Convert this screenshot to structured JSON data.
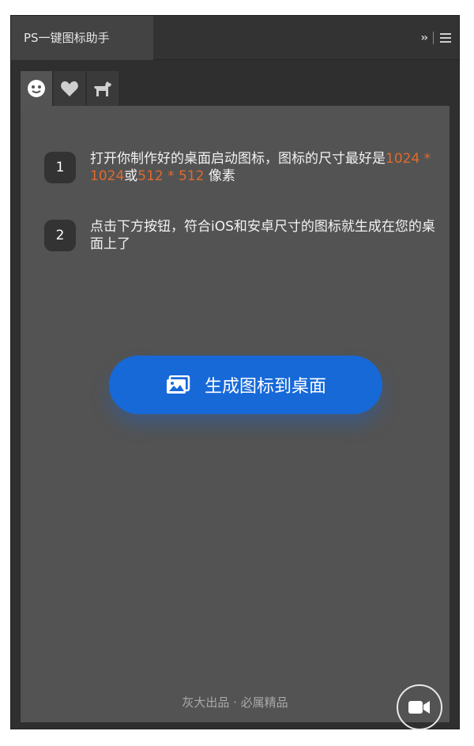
{
  "panel": {
    "tab_title": "PS一键图标助手"
  },
  "icon_tabs": [
    {
      "icon": "smiley-face-icon",
      "active": true
    },
    {
      "icon": "heart-icon",
      "active": false
    },
    {
      "icon": "dog-icon",
      "active": false
    }
  ],
  "steps": [
    {
      "number": "1",
      "text_before": "打开你制作好的桌面启动图标，图标的尺寸最好是",
      "highlight_1": "1024 * 1024",
      "text_middle": "或",
      "highlight_2": "512 * 512",
      "text_after": " 像素"
    },
    {
      "number": "2",
      "text": "点击下方按钮，符合iOS和安卓尺寸的图标就生成在您的桌面上了"
    }
  ],
  "primary_button": {
    "label": "生成图标到桌面",
    "icon": "image-icon"
  },
  "footer": {
    "text": "灰大出品 · 必属精品"
  },
  "video_button": {
    "icon": "video-camera-icon"
  },
  "colors": {
    "accent_blue": "#1769d8",
    "highlight_orange": "#e06a2c",
    "panel_bg": "#535353"
  }
}
